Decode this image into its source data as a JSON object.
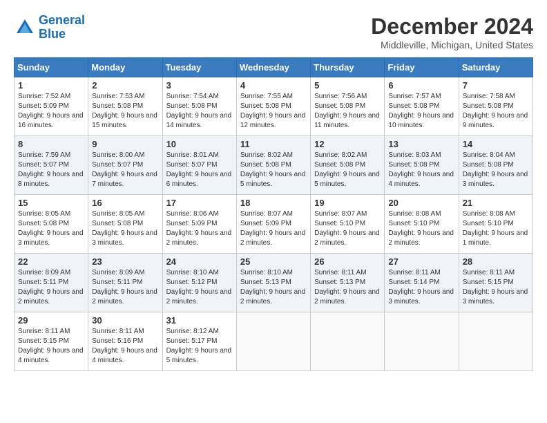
{
  "logo": {
    "text_general": "General",
    "text_blue": "Blue"
  },
  "title": "December 2024",
  "location": "Middleville, Michigan, United States",
  "headers": [
    "Sunday",
    "Monday",
    "Tuesday",
    "Wednesday",
    "Thursday",
    "Friday",
    "Saturday"
  ],
  "weeks": [
    [
      {
        "day": "1",
        "sunrise": "7:52 AM",
        "sunset": "5:09 PM",
        "daylight": "9 hours and 16 minutes."
      },
      {
        "day": "2",
        "sunrise": "7:53 AM",
        "sunset": "5:08 PM",
        "daylight": "9 hours and 15 minutes."
      },
      {
        "day": "3",
        "sunrise": "7:54 AM",
        "sunset": "5:08 PM",
        "daylight": "9 hours and 14 minutes."
      },
      {
        "day": "4",
        "sunrise": "7:55 AM",
        "sunset": "5:08 PM",
        "daylight": "9 hours and 12 minutes."
      },
      {
        "day": "5",
        "sunrise": "7:56 AM",
        "sunset": "5:08 PM",
        "daylight": "9 hours and 11 minutes."
      },
      {
        "day": "6",
        "sunrise": "7:57 AM",
        "sunset": "5:08 PM",
        "daylight": "9 hours and 10 minutes."
      },
      {
        "day": "7",
        "sunrise": "7:58 AM",
        "sunset": "5:08 PM",
        "daylight": "9 hours and 9 minutes."
      }
    ],
    [
      {
        "day": "8",
        "sunrise": "7:59 AM",
        "sunset": "5:07 PM",
        "daylight": "9 hours and 8 minutes."
      },
      {
        "day": "9",
        "sunrise": "8:00 AM",
        "sunset": "5:07 PM",
        "daylight": "9 hours and 7 minutes."
      },
      {
        "day": "10",
        "sunrise": "8:01 AM",
        "sunset": "5:07 PM",
        "daylight": "9 hours and 6 minutes."
      },
      {
        "day": "11",
        "sunrise": "8:02 AM",
        "sunset": "5:08 PM",
        "daylight": "9 hours and 5 minutes."
      },
      {
        "day": "12",
        "sunrise": "8:02 AM",
        "sunset": "5:08 PM",
        "daylight": "9 hours and 5 minutes."
      },
      {
        "day": "13",
        "sunrise": "8:03 AM",
        "sunset": "5:08 PM",
        "daylight": "9 hours and 4 minutes."
      },
      {
        "day": "14",
        "sunrise": "8:04 AM",
        "sunset": "5:08 PM",
        "daylight": "9 hours and 3 minutes."
      }
    ],
    [
      {
        "day": "15",
        "sunrise": "8:05 AM",
        "sunset": "5:08 PM",
        "daylight": "9 hours and 3 minutes."
      },
      {
        "day": "16",
        "sunrise": "8:05 AM",
        "sunset": "5:08 PM",
        "daylight": "9 hours and 3 minutes."
      },
      {
        "day": "17",
        "sunrise": "8:06 AM",
        "sunset": "5:09 PM",
        "daylight": "9 hours and 2 minutes."
      },
      {
        "day": "18",
        "sunrise": "8:07 AM",
        "sunset": "5:09 PM",
        "daylight": "9 hours and 2 minutes."
      },
      {
        "day": "19",
        "sunrise": "8:07 AM",
        "sunset": "5:10 PM",
        "daylight": "9 hours and 2 minutes."
      },
      {
        "day": "20",
        "sunrise": "8:08 AM",
        "sunset": "5:10 PM",
        "daylight": "9 hours and 2 minutes."
      },
      {
        "day": "21",
        "sunrise": "8:08 AM",
        "sunset": "5:10 PM",
        "daylight": "9 hours and 1 minute."
      }
    ],
    [
      {
        "day": "22",
        "sunrise": "8:09 AM",
        "sunset": "5:11 PM",
        "daylight": "9 hours and 2 minutes."
      },
      {
        "day": "23",
        "sunrise": "8:09 AM",
        "sunset": "5:11 PM",
        "daylight": "9 hours and 2 minutes."
      },
      {
        "day": "24",
        "sunrise": "8:10 AM",
        "sunset": "5:12 PM",
        "daylight": "9 hours and 2 minutes."
      },
      {
        "day": "25",
        "sunrise": "8:10 AM",
        "sunset": "5:13 PM",
        "daylight": "9 hours and 2 minutes."
      },
      {
        "day": "26",
        "sunrise": "8:11 AM",
        "sunset": "5:13 PM",
        "daylight": "9 hours and 2 minutes."
      },
      {
        "day": "27",
        "sunrise": "8:11 AM",
        "sunset": "5:14 PM",
        "daylight": "9 hours and 3 minutes."
      },
      {
        "day": "28",
        "sunrise": "8:11 AM",
        "sunset": "5:15 PM",
        "daylight": "9 hours and 3 minutes."
      }
    ],
    [
      {
        "day": "29",
        "sunrise": "8:11 AM",
        "sunset": "5:15 PM",
        "daylight": "9 hours and 4 minutes."
      },
      {
        "day": "30",
        "sunrise": "8:11 AM",
        "sunset": "5:16 PM",
        "daylight": "9 hours and 4 minutes."
      },
      {
        "day": "31",
        "sunrise": "8:12 AM",
        "sunset": "5:17 PM",
        "daylight": "9 hours and 5 minutes."
      },
      null,
      null,
      null,
      null
    ]
  ]
}
